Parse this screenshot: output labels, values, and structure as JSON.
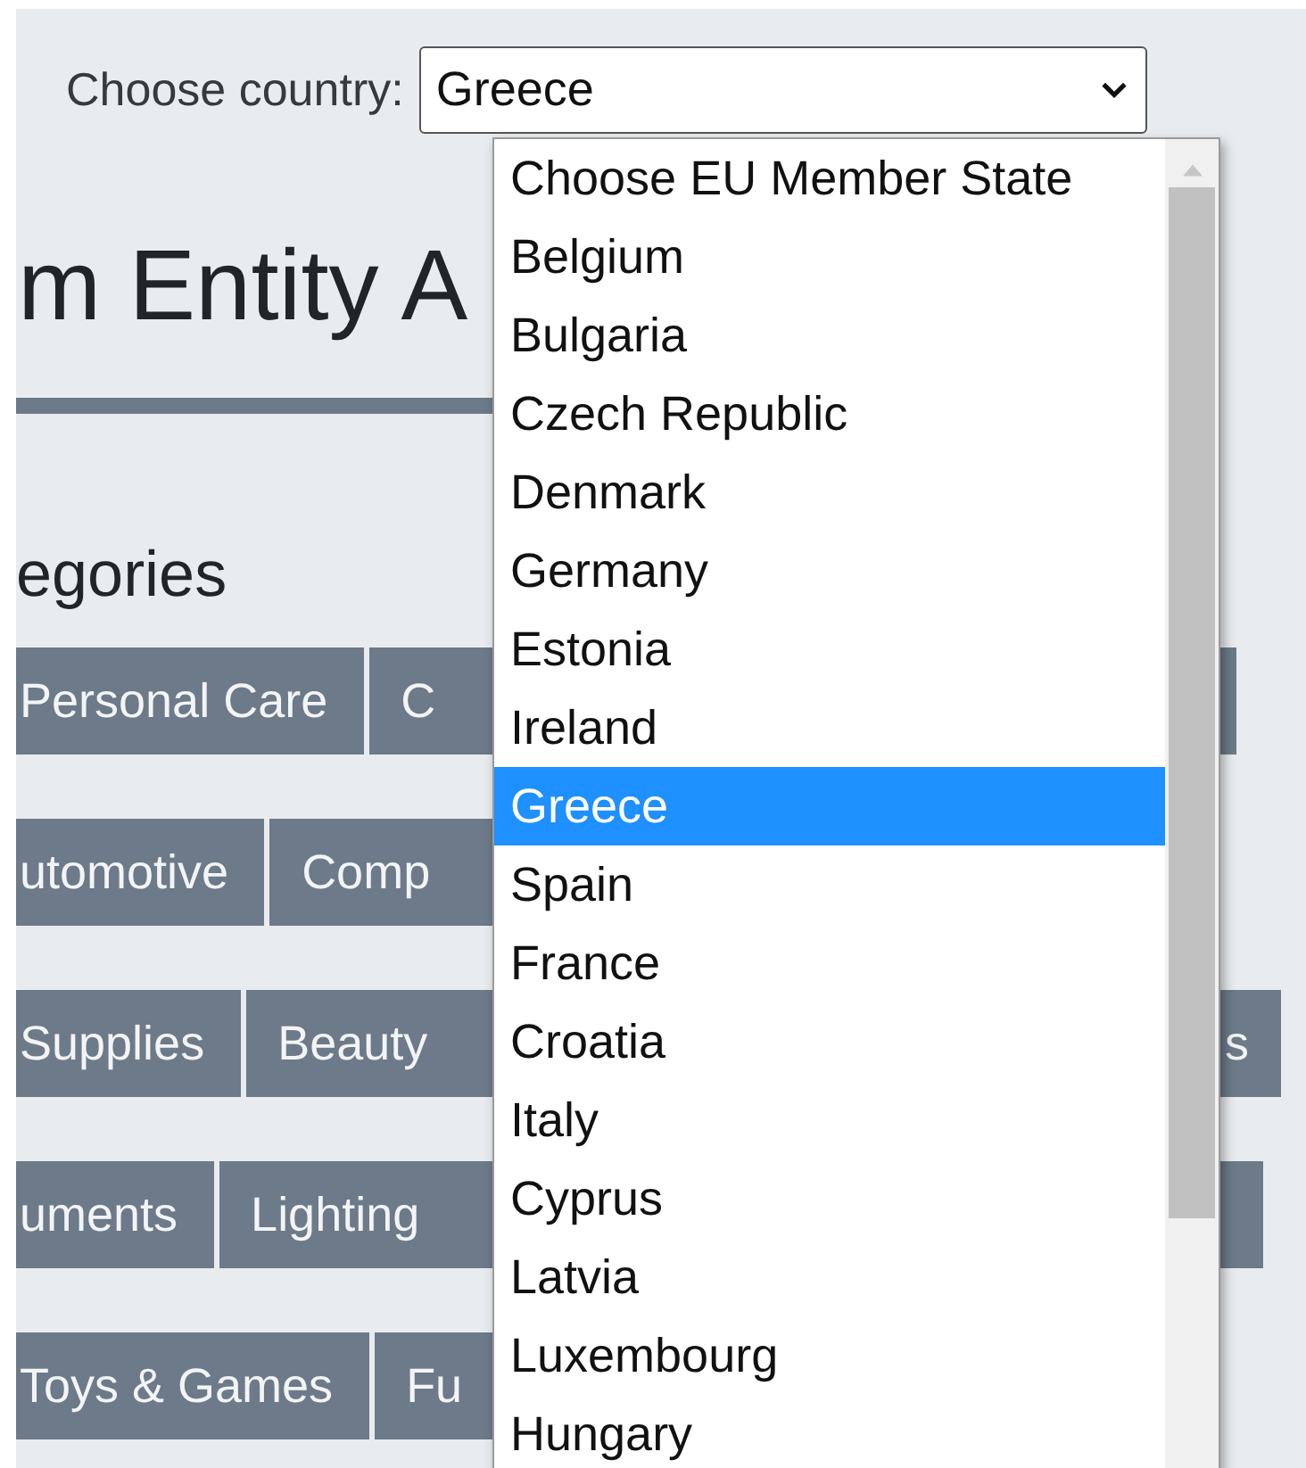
{
  "country_picker": {
    "label": "Choose country:",
    "value": "Greece",
    "options": [
      {
        "label": "Choose EU Member State",
        "selected": false
      },
      {
        "label": "Belgium",
        "selected": false
      },
      {
        "label": "Bulgaria",
        "selected": false
      },
      {
        "label": "Czech Republic",
        "selected": false
      },
      {
        "label": "Denmark",
        "selected": false
      },
      {
        "label": "Germany",
        "selected": false
      },
      {
        "label": "Estonia",
        "selected": false
      },
      {
        "label": "Ireland",
        "selected": false
      },
      {
        "label": "Greece",
        "selected": true
      },
      {
        "label": "Spain",
        "selected": false
      },
      {
        "label": "France",
        "selected": false
      },
      {
        "label": "Croatia",
        "selected": false
      },
      {
        "label": "Italy",
        "selected": false
      },
      {
        "label": "Cyprus",
        "selected": false
      },
      {
        "label": "Latvia",
        "selected": false
      },
      {
        "label": "Luxembourg",
        "selected": false
      },
      {
        "label": "Hungary",
        "selected": false
      }
    ]
  },
  "heading": "m Entity A",
  "section_title": "egories",
  "category_rows": [
    {
      "tags": [
        "Personal Care",
        "C"
      ],
      "right_tags": [
        {
          "kind": "tag"
        }
      ]
    },
    {
      "tags": [
        "utomotive",
        "Comp"
      ],
      "right_tags": []
    },
    {
      "tags": [
        "Supplies",
        "Beauty"
      ],
      "right_tags": [
        {
          "kind": "tag",
          "label": "s"
        }
      ]
    },
    {
      "tags": [
        "uments",
        "Lighting"
      ],
      "right_tags": [
        {
          "kind": "tag"
        }
      ]
    },
    {
      "tags": [
        "Toys & Games",
        "Fu"
      ],
      "right_tags": []
    }
  ]
}
